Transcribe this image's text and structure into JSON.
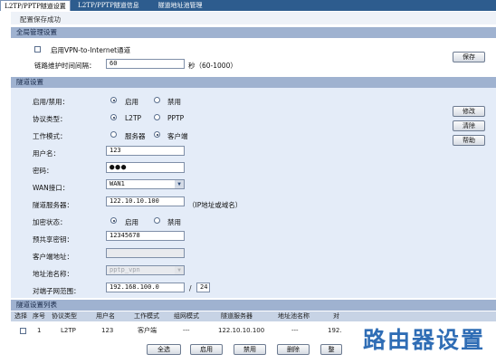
{
  "tabs": [
    {
      "label": "L2TP/PPTP隧道设置"
    },
    {
      "label": "L2TP/PPTP隧道信息"
    },
    {
      "label": "隧道地址池管理"
    }
  ],
  "status": "配置保存成功",
  "global": {
    "title": "全局管理设置",
    "vpn_checkbox_label": "启用VPN-to-Internet通道",
    "vpn_checked": false,
    "keepalive_label": "链路维护时间间隔：",
    "keepalive_value": "60",
    "keepalive_unit": "秒（60-1000）",
    "save_label": "保存"
  },
  "tunnel": {
    "title": "隧道设置",
    "enable": {
      "label": "启用/禁用：",
      "opt_on": "启用",
      "opt_off": "禁用",
      "selected": "启用"
    },
    "protocol": {
      "label": "协议类型：",
      "opt_a": "L2TP",
      "opt_b": "PPTP",
      "selected": "L2TP"
    },
    "mode": {
      "label": "工作模式：",
      "opt_a": "服务器",
      "opt_b": "客户端",
      "selected": "客户端"
    },
    "username": {
      "label": "用户名：",
      "value": "123"
    },
    "password": {
      "label": "密码：",
      "value": "●●●"
    },
    "wan": {
      "label": "WAN接口：",
      "value": "WAN1"
    },
    "server": {
      "label": "隧道服务器：",
      "value": "122.10.10.100",
      "hint": "（IP地址或域名）"
    },
    "encrypt": {
      "label": "加密状态：",
      "opt_on": "启用",
      "opt_off": "禁用",
      "selected": "启用"
    },
    "psk": {
      "label": "预共享密钥：",
      "value": "12345678"
    },
    "client_addr": {
      "label": "客户端地址：",
      "value": ""
    },
    "pool": {
      "label": "地址池名称：",
      "value": "pptp_vpn"
    },
    "subnet": {
      "label": "对端子网范围：",
      "value": "192.168.100.0",
      "sep": "/",
      "mask": "24"
    },
    "modify_label": "修改",
    "clear_label": "清除",
    "help_label": "帮助"
  },
  "list": {
    "title": "隧道设置列表",
    "headers": [
      "选择",
      "序号",
      "协议类型",
      "用户名",
      "工作模式",
      "组网模式",
      "隧道服务器",
      "地址池名称",
      "对"
    ],
    "rows": [
      [
        "",
        "1",
        "L2TP",
        "123",
        "客户端",
        "---",
        "122.10.10.100",
        "---",
        "192."
      ]
    ]
  },
  "actions": {
    "select_all": "全选",
    "enable": "启用",
    "disable": "禁用",
    "delete": "删除",
    "more": "整"
  },
  "watermark": "路由器设置"
}
